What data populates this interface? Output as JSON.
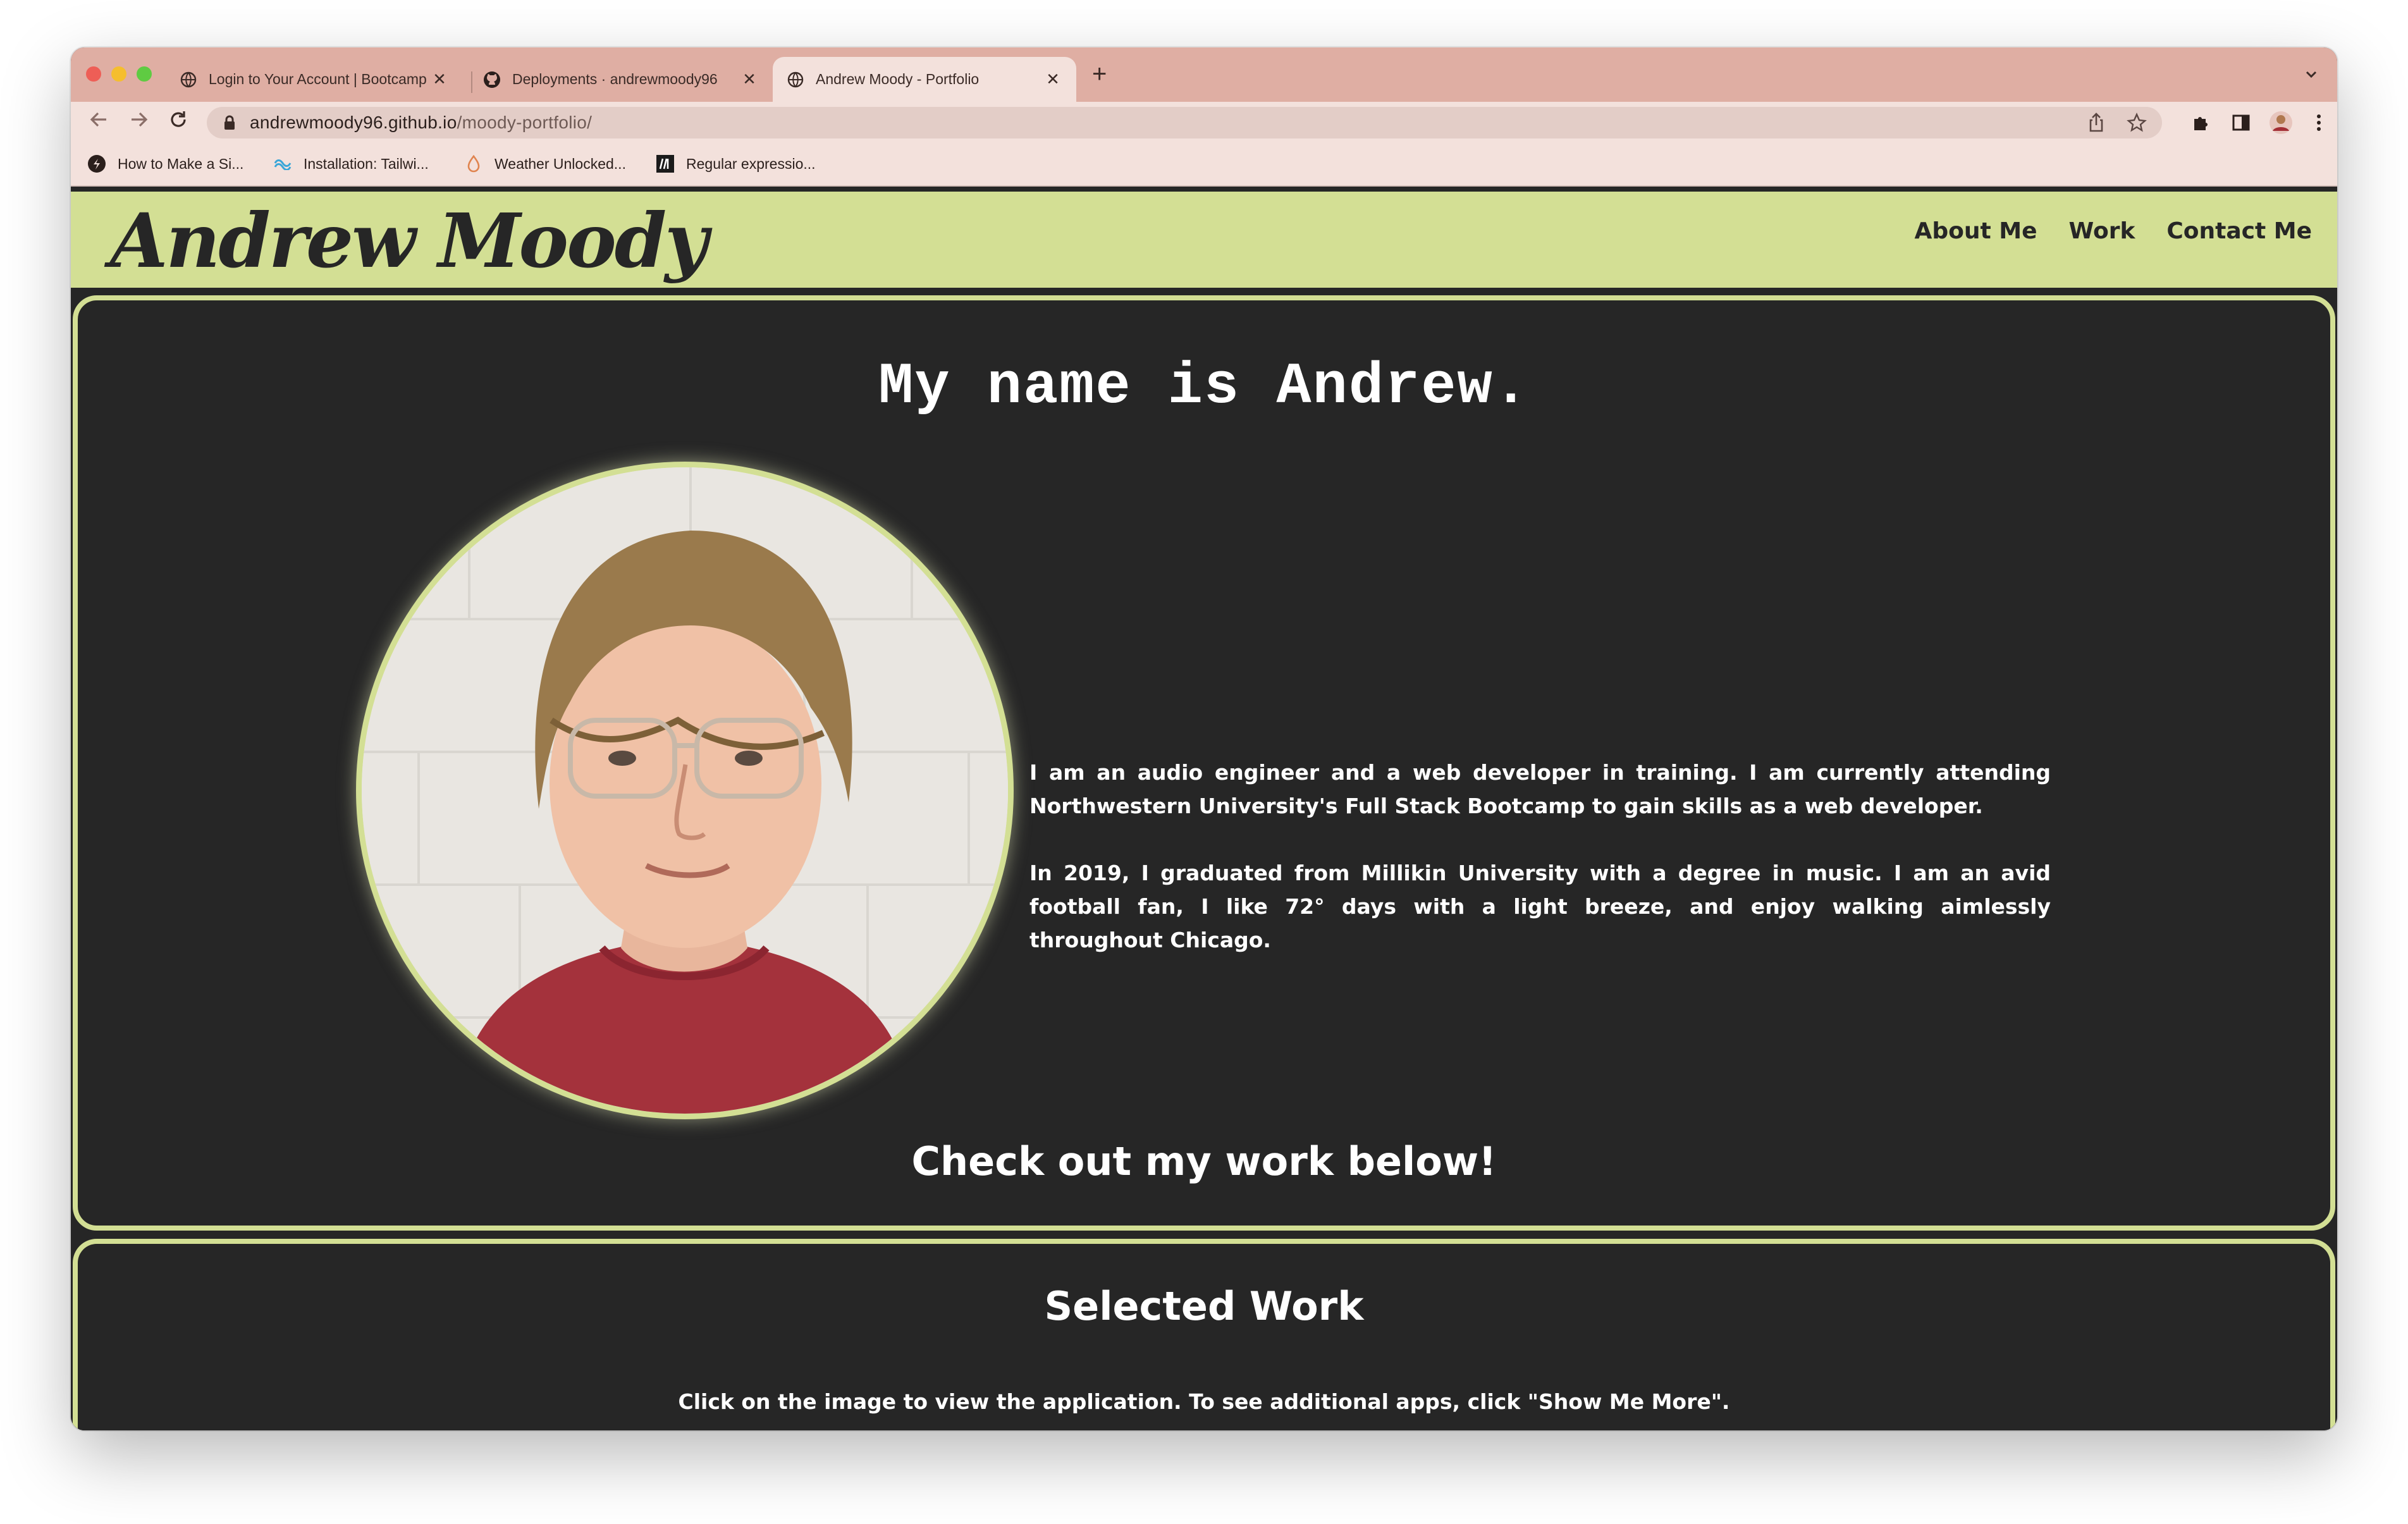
{
  "browser": {
    "tabs": [
      {
        "title": "Login to Your Account | Bootcamp"
      },
      {
        "title": "Deployments · andrewmoody96"
      },
      {
        "title": "Andrew Moody - Portfolio"
      }
    ],
    "active_tab": 2,
    "url_host": "andrewmoody96.github.io",
    "url_path": "/moody-portfolio/",
    "bookmarks": [
      {
        "label": "How to Make a Si..."
      },
      {
        "label": "Installation: Tailwi..."
      },
      {
        "label": "Weather Unlocked..."
      },
      {
        "label": "Regular expressio..."
      }
    ]
  },
  "site": {
    "logo": "Andrew Moody",
    "nav": [
      "About Me",
      "Work",
      "Contact Me"
    ]
  },
  "about": {
    "heading": "My name is Andrew.",
    "bio": [
      "I am an audio engineer and a web developer in training. I am currently attending Northwestern University's Full Stack Bootcamp to gain skills as a web developer.",
      "In 2019, I graduated from Millikin University with a degree in music. I am an avid football fan, I like 72° days with a light breeze, and enjoy walking aimlessly throughout Chicago."
    ],
    "cta": "Check out my work below!"
  },
  "work": {
    "title": "Selected Work",
    "description": "Click on the image to view the application. To see additional apps, click \"Show Me More\"."
  },
  "colors": {
    "accent": "#d3df94",
    "page_bg": "#262626",
    "tab_bar": "#dfaea3",
    "toolbar": "#f3e1dc"
  }
}
